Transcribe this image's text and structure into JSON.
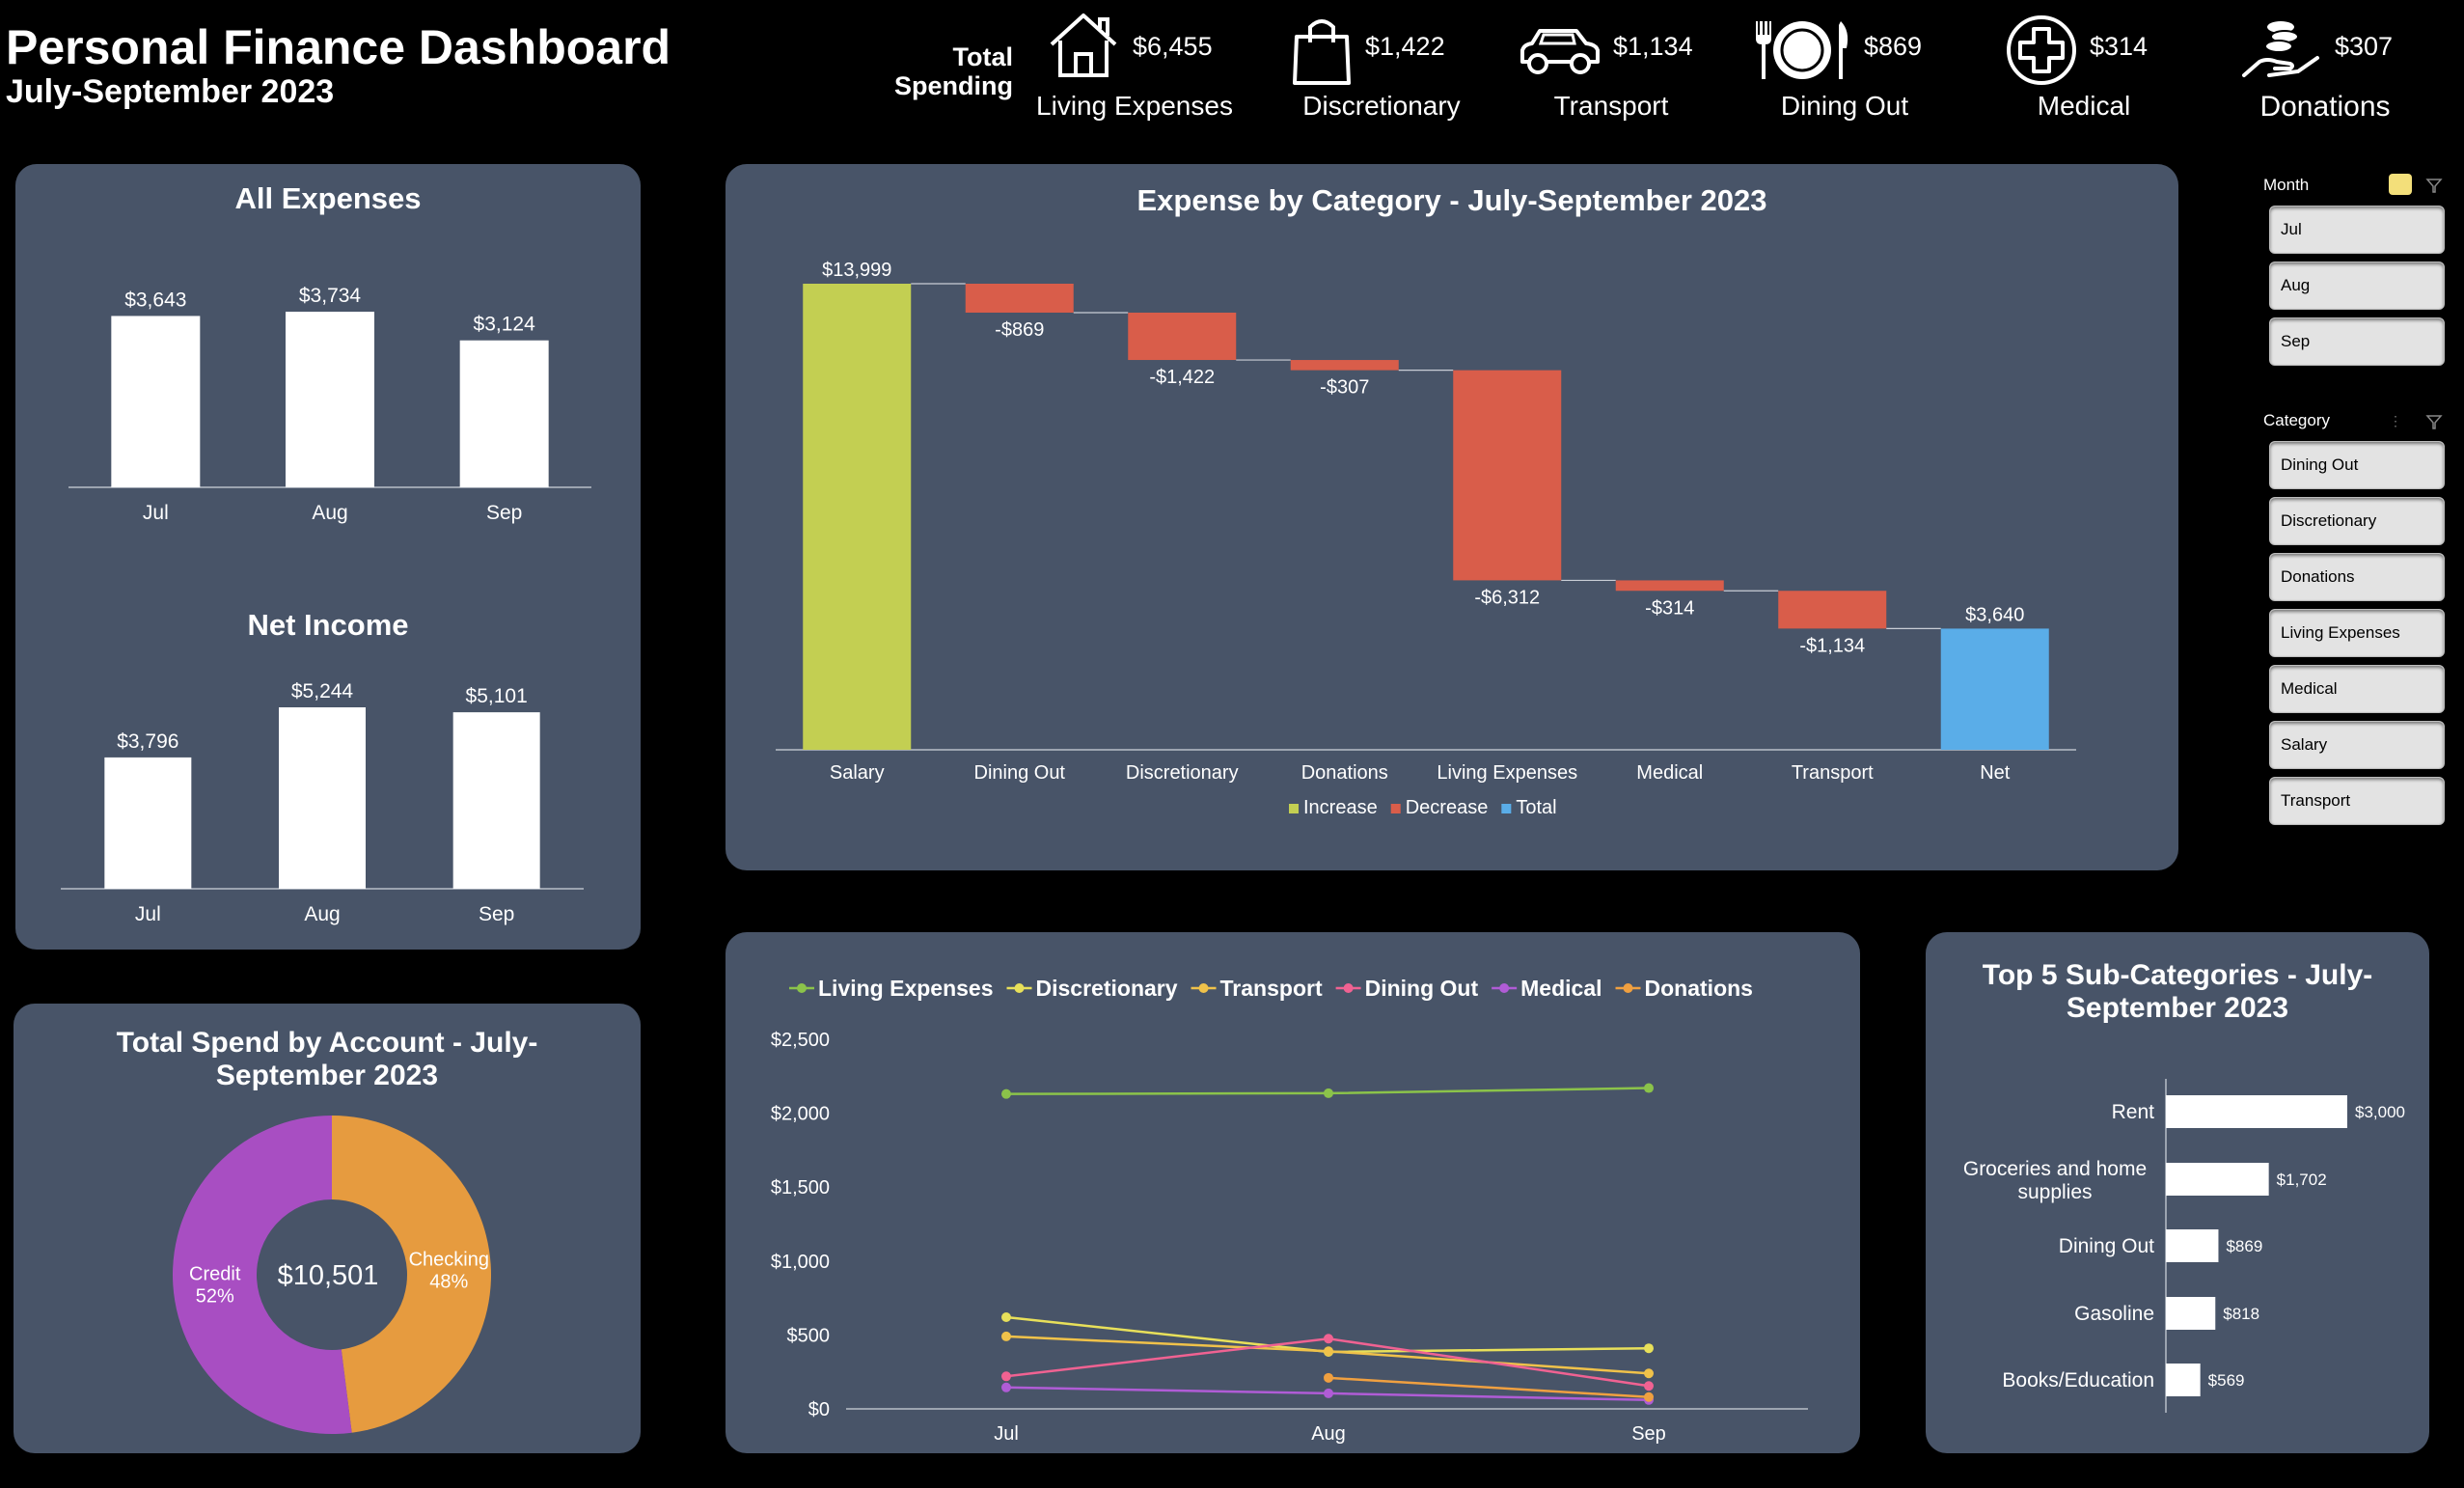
{
  "header": {
    "title": "Personal Finance Dashboard",
    "subtitle": "July-September 2023",
    "total_spending_label": [
      "Total",
      "Spending"
    ]
  },
  "kpis": [
    {
      "icon": "house-icon",
      "value": "$6,455",
      "label": "Living Expenses"
    },
    {
      "icon": "shopping-bag-icon",
      "value": "$1,422",
      "label": "Discretionary"
    },
    {
      "icon": "car-icon",
      "value": "$1,134",
      "label": "Transport"
    },
    {
      "icon": "plate-cutlery-icon",
      "value": "$869",
      "label": "Dining Out"
    },
    {
      "icon": "medical-cross-icon",
      "value": "$314",
      "label": "Medical"
    },
    {
      "icon": "donation-hand-icon",
      "value": "$307",
      "label": "Donations"
    }
  ],
  "slicers": {
    "month": {
      "title": "Month",
      "items": [
        "Jul",
        "Aug",
        "Sep"
      ]
    },
    "category": {
      "title": "Category",
      "items": [
        "Dining Out",
        "Discretionary",
        "Donations",
        "Living Expenses",
        "Medical",
        "Salary",
        "Transport"
      ]
    }
  },
  "colors": {
    "panel": "#485468",
    "increase": "#c3cf52",
    "decrease": "#d95d4a",
    "total": "#5aade8",
    "credit": "#a84ec2",
    "checking": "#e69b3f",
    "living_expenses": "#8bc34a",
    "discretionary": "#e8e05a",
    "transport": "#f0c24a",
    "dining_out": "#f06292",
    "medical": "#b05cd6",
    "donations": "#f0a040"
  },
  "chart_data": [
    {
      "id": "all_expenses",
      "type": "bar",
      "title": "All Expenses",
      "categories": [
        "Jul",
        "Aug",
        "Sep"
      ],
      "values": [
        3643,
        3734,
        3124
      ],
      "data_labels": [
        "$3,643",
        "$3,734",
        "$3,124"
      ]
    },
    {
      "id": "net_income",
      "type": "bar",
      "title": "Net Income",
      "categories": [
        "Jul",
        "Aug",
        "Sep"
      ],
      "values": [
        3796,
        5244,
        5101
      ],
      "data_labels": [
        "$3,796",
        "$5,244",
        "$5,101"
      ]
    },
    {
      "id": "waterfall",
      "type": "bar",
      "subtype": "waterfall",
      "title": "Expense by Category - July-September 2023",
      "categories": [
        "Salary",
        "Dining Out",
        "Discretionary",
        "Donations",
        "Living Expenses",
        "Medical",
        "Transport",
        "Net"
      ],
      "values": [
        13999,
        -869,
        -1422,
        -307,
        -6312,
        -314,
        -1134,
        3640
      ],
      "kinds": [
        "increase",
        "decrease",
        "decrease",
        "decrease",
        "decrease",
        "decrease",
        "decrease",
        "total"
      ],
      "data_labels": [
        "$13,999",
        "-$869",
        "-$1,422",
        "-$307",
        "-$6,312",
        "-$314",
        "-$1,134",
        "$3,640"
      ],
      "legend": [
        "Increase",
        "Decrease",
        "Total"
      ],
      "legend_position": "bottom"
    },
    {
      "id": "account_donut",
      "type": "pie",
      "subtype": "donut",
      "title": "Total Spend by Account - July-September 2023",
      "center_label": "$10,501",
      "slices": [
        {
          "label": "Checking",
          "percent_label": "48%",
          "value": 48
        },
        {
          "label": "Credit",
          "percent_label": "52%",
          "value": 52
        }
      ]
    },
    {
      "id": "category_trend",
      "type": "line",
      "x": [
        "Jul",
        "Aug",
        "Sep"
      ],
      "ylim": [
        0,
        2500
      ],
      "yticks": [
        "$0",
        "$500",
        "$1,000",
        "$1,500",
        "$2,000",
        "$2,500"
      ],
      "ytick_values": [
        0,
        500,
        1000,
        1500,
        2000,
        2500
      ],
      "legend_position": "top",
      "series": [
        {
          "name": "Living Expenses",
          "values": [
            2130,
            2135,
            2170
          ]
        },
        {
          "name": "Discretionary",
          "values": [
            620,
            385,
            410
          ]
        },
        {
          "name": "Transport",
          "values": [
            490,
            390,
            240
          ]
        },
        {
          "name": "Dining Out",
          "values": [
            220,
            475,
            155
          ]
        },
        {
          "name": "Medical",
          "values": [
            145,
            105,
            60
          ]
        },
        {
          "name": "Donations",
          "values": [
            null,
            210,
            80
          ]
        }
      ]
    },
    {
      "id": "top5_subcategories",
      "type": "bar",
      "orientation": "horizontal",
      "title": "Top 5 Sub-Categories - July-September 2023",
      "categories": [
        "Rent",
        "Groceries and home supplies",
        "Dining Out",
        "Gasoline",
        "Books/Education"
      ],
      "values": [
        3000,
        1702,
        869,
        818,
        569
      ],
      "data_labels": [
        "$3,000",
        "$1,702",
        "$869",
        "$818",
        "$569"
      ]
    }
  ]
}
